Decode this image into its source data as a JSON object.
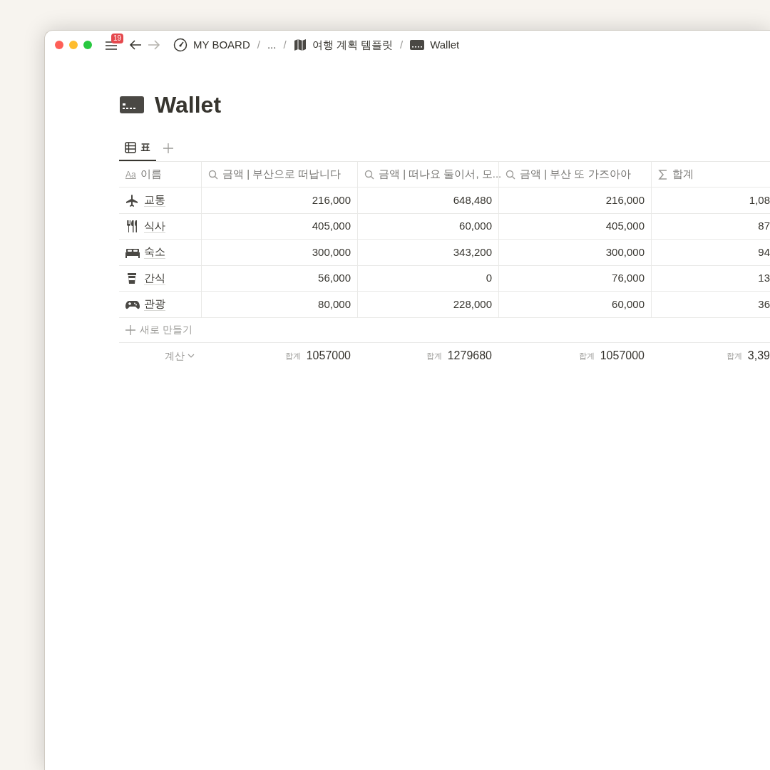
{
  "toolbar": {
    "badge": "19",
    "breadcrumbs": [
      {
        "kind": "gauge",
        "label": "MY BOARD"
      },
      {
        "kind": "none",
        "separator": "/",
        "label": "..."
      },
      {
        "kind": "map",
        "separator": "/",
        "label": "여행 계획 템플릿"
      },
      {
        "kind": "card",
        "separator": "/",
        "label": "Wallet"
      }
    ]
  },
  "page": {
    "title": "Wallet"
  },
  "tabs": [
    {
      "label": "표",
      "selected": true
    }
  ],
  "table": {
    "columns": [
      {
        "kind": "title",
        "prefix": "Aa",
        "label": "이름"
      },
      {
        "kind": "lookup",
        "label": "금액 | 부산으로 떠납니다"
      },
      {
        "kind": "lookup",
        "label": "금액 | 떠나요 둘이서, 모..."
      },
      {
        "kind": "lookup",
        "label": "금액 | 부산 또 가즈아아"
      },
      {
        "kind": "formula",
        "label": "합계"
      }
    ],
    "rows": [
      {
        "kind": "plane",
        "cells": [
          "교통",
          "216,000",
          "648,480",
          "216,000",
          "1,08"
        ]
      },
      {
        "kind": "utensils",
        "cells": [
          "식사",
          "405,000",
          "60,000",
          "405,000",
          "87"
        ]
      },
      {
        "kind": "bed",
        "cells": [
          "숙소",
          "300,000",
          "343,200",
          "300,000",
          "94"
        ]
      },
      {
        "kind": "cup",
        "cells": [
          "간식",
          "56,000",
          "0",
          "76,000",
          "13"
        ]
      },
      {
        "kind": "gamepad",
        "cells": [
          "관광",
          "80,000",
          "228,000",
          "60,000",
          "36"
        ]
      }
    ],
    "new_row": "새로 만들기",
    "footer": {
      "label": "계산",
      "cells": [
        {
          "label": "합계",
          "value": "1057000"
        },
        {
          "label": "합계",
          "value": "1279680"
        },
        {
          "label": "합계",
          "value": "1057000"
        },
        {
          "label": "합계",
          "value": "3,39"
        }
      ]
    }
  }
}
